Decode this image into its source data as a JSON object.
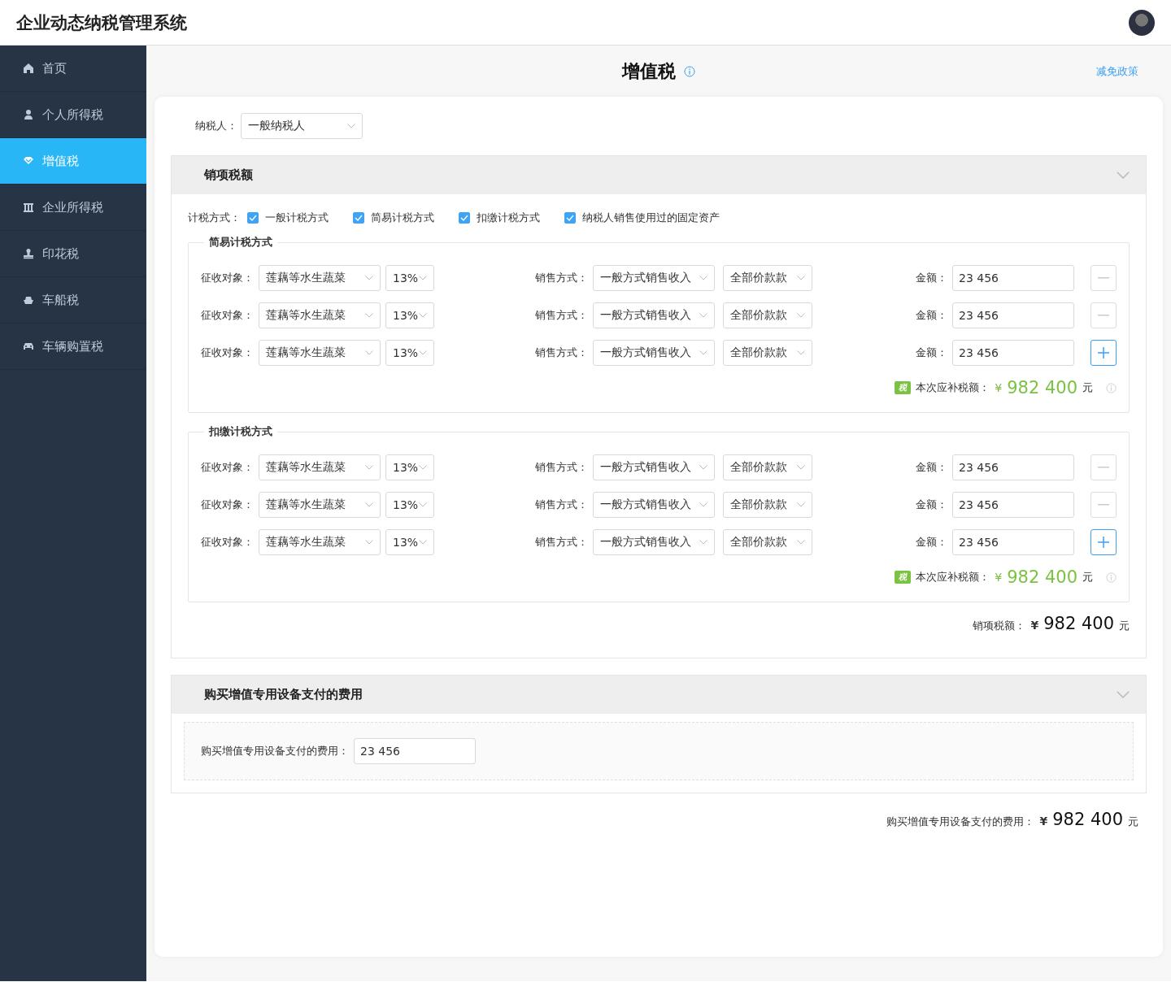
{
  "app_title": "企业动态纳税管理系统",
  "sidebar": {
    "items": [
      {
        "label": "首页",
        "selected": false
      },
      {
        "label": "个人所得税",
        "selected": false
      },
      {
        "label": "增值税",
        "selected": true
      },
      {
        "label": "企业所得税",
        "selected": false
      },
      {
        "label": "印花税",
        "selected": false
      },
      {
        "label": "车船税",
        "selected": false
      },
      {
        "label": "车辆购置税",
        "selected": false
      }
    ]
  },
  "page": {
    "title": "增值税",
    "link": "减免政策"
  },
  "taxpayer": {
    "label": "纳税人：",
    "value": "一般纳税人"
  },
  "sales_section": {
    "title": "销项税额",
    "expanded": true,
    "methods_label": "计税方式：",
    "methods": [
      {
        "label": "一般计税方式",
        "checked": true
      },
      {
        "label": "简易计税方式",
        "checked": true
      },
      {
        "label": "扣缴计税方式",
        "checked": true
      },
      {
        "label": "纳税人销售使用过的固定资产",
        "checked": true
      }
    ],
    "groups": [
      {
        "title": "简易计税方式",
        "rows": [
          {
            "object_label": "征收对象：",
            "object": "莲藕等水生蔬菜",
            "rate": "13%",
            "method_label": "销售方式：",
            "method": "一般方式销售收入",
            "price": "全部价款款",
            "amount_label": "金额：",
            "amount": "23 456",
            "kind": "remove"
          },
          {
            "object_label": "征收对象：",
            "object": "莲藕等水生蔬菜",
            "rate": "13%",
            "method_label": "销售方式：",
            "method": "一般方式销售收入",
            "price": "全部价款款",
            "amount_label": "金额：",
            "amount": "23 456",
            "kind": "remove"
          },
          {
            "object_label": "征收对象：",
            "object": "莲藕等水生蔬菜",
            "rate": "13%",
            "method_label": "销售方式：",
            "method": "一般方式销售收入",
            "price": "全部价款款",
            "amount_label": "金额：",
            "amount": "23 456",
            "kind": "add"
          }
        ],
        "summary": {
          "badge": "税",
          "label": "本次应补税额：",
          "currency": "¥",
          "value": "982 400",
          "unit": "元"
        }
      },
      {
        "title": "扣缴计税方式",
        "rows": [
          {
            "object_label": "征收对象：",
            "object": "莲藕等水生蔬菜",
            "rate": "13%",
            "method_label": "销售方式：",
            "method": "一般方式销售收入",
            "price": "全部价款款",
            "amount_label": "金额：",
            "amount": "23 456",
            "kind": "remove"
          },
          {
            "object_label": "征收对象：",
            "object": "莲藕等水生蔬菜",
            "rate": "13%",
            "method_label": "销售方式：",
            "method": "一般方式销售收入",
            "price": "全部价款款",
            "amount_label": "金额：",
            "amount": "23 456",
            "kind": "remove"
          },
          {
            "object_label": "征收对象：",
            "object": "莲藕等水生蔬菜",
            "rate": "13%",
            "method_label": "销售方式：",
            "method": "一般方式销售收入",
            "price": "全部价款款",
            "amount_label": "金额：",
            "amount": "23 456",
            "kind": "add"
          }
        ],
        "summary": {
          "badge": "税",
          "label": "本次应补税额：",
          "currency": "¥",
          "value": "982 400",
          "unit": "元"
        }
      }
    ],
    "total": {
      "label": "销项税额：",
      "currency": "¥",
      "value": "982 400",
      "unit": "元"
    }
  },
  "equipment_section": {
    "title": "购买增值专用设备支付的费用",
    "expanded": true,
    "field_label": "购买增值专用设备支付的费用：",
    "field_value": "23 456"
  },
  "grand_total": {
    "label": "购买增值专用设备支付的费用：",
    "currency": "¥",
    "value": "982 400",
    "unit": "元"
  }
}
